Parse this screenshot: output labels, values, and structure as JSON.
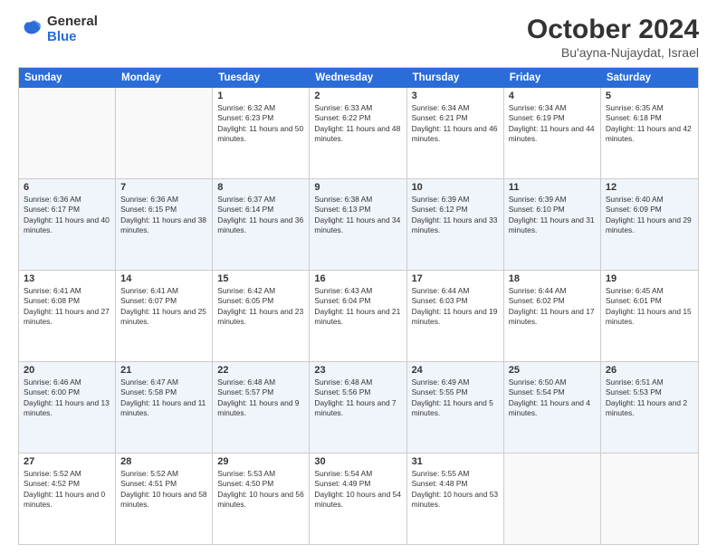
{
  "logo": {
    "general": "General",
    "blue": "Blue"
  },
  "title": "October 2024",
  "subtitle": "Bu'ayna-Nujaydat, Israel",
  "days": [
    "Sunday",
    "Monday",
    "Tuesday",
    "Wednesday",
    "Thursday",
    "Friday",
    "Saturday"
  ],
  "weeks": [
    [
      {
        "day": "",
        "sunrise": "",
        "sunset": "",
        "daylight": "",
        "empty": true
      },
      {
        "day": "",
        "sunrise": "",
        "sunset": "",
        "daylight": "",
        "empty": true
      },
      {
        "day": "1",
        "sunrise": "Sunrise: 6:32 AM",
        "sunset": "Sunset: 6:23 PM",
        "daylight": "Daylight: 11 hours and 50 minutes."
      },
      {
        "day": "2",
        "sunrise": "Sunrise: 6:33 AM",
        "sunset": "Sunset: 6:22 PM",
        "daylight": "Daylight: 11 hours and 48 minutes."
      },
      {
        "day": "3",
        "sunrise": "Sunrise: 6:34 AM",
        "sunset": "Sunset: 6:21 PM",
        "daylight": "Daylight: 11 hours and 46 minutes."
      },
      {
        "day": "4",
        "sunrise": "Sunrise: 6:34 AM",
        "sunset": "Sunset: 6:19 PM",
        "daylight": "Daylight: 11 hours and 44 minutes."
      },
      {
        "day": "5",
        "sunrise": "Sunrise: 6:35 AM",
        "sunset": "Sunset: 6:18 PM",
        "daylight": "Daylight: 11 hours and 42 minutes."
      }
    ],
    [
      {
        "day": "6",
        "sunrise": "Sunrise: 6:36 AM",
        "sunset": "Sunset: 6:17 PM",
        "daylight": "Daylight: 11 hours and 40 minutes."
      },
      {
        "day": "7",
        "sunrise": "Sunrise: 6:36 AM",
        "sunset": "Sunset: 6:15 PM",
        "daylight": "Daylight: 11 hours and 38 minutes."
      },
      {
        "day": "8",
        "sunrise": "Sunrise: 6:37 AM",
        "sunset": "Sunset: 6:14 PM",
        "daylight": "Daylight: 11 hours and 36 minutes."
      },
      {
        "day": "9",
        "sunrise": "Sunrise: 6:38 AM",
        "sunset": "Sunset: 6:13 PM",
        "daylight": "Daylight: 11 hours and 34 minutes."
      },
      {
        "day": "10",
        "sunrise": "Sunrise: 6:39 AM",
        "sunset": "Sunset: 6:12 PM",
        "daylight": "Daylight: 11 hours and 33 minutes."
      },
      {
        "day": "11",
        "sunrise": "Sunrise: 6:39 AM",
        "sunset": "Sunset: 6:10 PM",
        "daylight": "Daylight: 11 hours and 31 minutes."
      },
      {
        "day": "12",
        "sunrise": "Sunrise: 6:40 AM",
        "sunset": "Sunset: 6:09 PM",
        "daylight": "Daylight: 11 hours and 29 minutes."
      }
    ],
    [
      {
        "day": "13",
        "sunrise": "Sunrise: 6:41 AM",
        "sunset": "Sunset: 6:08 PM",
        "daylight": "Daylight: 11 hours and 27 minutes."
      },
      {
        "day": "14",
        "sunrise": "Sunrise: 6:41 AM",
        "sunset": "Sunset: 6:07 PM",
        "daylight": "Daylight: 11 hours and 25 minutes."
      },
      {
        "day": "15",
        "sunrise": "Sunrise: 6:42 AM",
        "sunset": "Sunset: 6:05 PM",
        "daylight": "Daylight: 11 hours and 23 minutes."
      },
      {
        "day": "16",
        "sunrise": "Sunrise: 6:43 AM",
        "sunset": "Sunset: 6:04 PM",
        "daylight": "Daylight: 11 hours and 21 minutes."
      },
      {
        "day": "17",
        "sunrise": "Sunrise: 6:44 AM",
        "sunset": "Sunset: 6:03 PM",
        "daylight": "Daylight: 11 hours and 19 minutes."
      },
      {
        "day": "18",
        "sunrise": "Sunrise: 6:44 AM",
        "sunset": "Sunset: 6:02 PM",
        "daylight": "Daylight: 11 hours and 17 minutes."
      },
      {
        "day": "19",
        "sunrise": "Sunrise: 6:45 AM",
        "sunset": "Sunset: 6:01 PM",
        "daylight": "Daylight: 11 hours and 15 minutes."
      }
    ],
    [
      {
        "day": "20",
        "sunrise": "Sunrise: 6:46 AM",
        "sunset": "Sunset: 6:00 PM",
        "daylight": "Daylight: 11 hours and 13 minutes."
      },
      {
        "day": "21",
        "sunrise": "Sunrise: 6:47 AM",
        "sunset": "Sunset: 5:58 PM",
        "daylight": "Daylight: 11 hours and 11 minutes."
      },
      {
        "day": "22",
        "sunrise": "Sunrise: 6:48 AM",
        "sunset": "Sunset: 5:57 PM",
        "daylight": "Daylight: 11 hours and 9 minutes."
      },
      {
        "day": "23",
        "sunrise": "Sunrise: 6:48 AM",
        "sunset": "Sunset: 5:56 PM",
        "daylight": "Daylight: 11 hours and 7 minutes."
      },
      {
        "day": "24",
        "sunrise": "Sunrise: 6:49 AM",
        "sunset": "Sunset: 5:55 PM",
        "daylight": "Daylight: 11 hours and 5 minutes."
      },
      {
        "day": "25",
        "sunrise": "Sunrise: 6:50 AM",
        "sunset": "Sunset: 5:54 PM",
        "daylight": "Daylight: 11 hours and 4 minutes."
      },
      {
        "day": "26",
        "sunrise": "Sunrise: 6:51 AM",
        "sunset": "Sunset: 5:53 PM",
        "daylight": "Daylight: 11 hours and 2 minutes."
      }
    ],
    [
      {
        "day": "27",
        "sunrise": "Sunrise: 5:52 AM",
        "sunset": "Sunset: 4:52 PM",
        "daylight": "Daylight: 11 hours and 0 minutes."
      },
      {
        "day": "28",
        "sunrise": "Sunrise: 5:52 AM",
        "sunset": "Sunset: 4:51 PM",
        "daylight": "Daylight: 10 hours and 58 minutes."
      },
      {
        "day": "29",
        "sunrise": "Sunrise: 5:53 AM",
        "sunset": "Sunset: 4:50 PM",
        "daylight": "Daylight: 10 hours and 56 minutes."
      },
      {
        "day": "30",
        "sunrise": "Sunrise: 5:54 AM",
        "sunset": "Sunset: 4:49 PM",
        "daylight": "Daylight: 10 hours and 54 minutes."
      },
      {
        "day": "31",
        "sunrise": "Sunrise: 5:55 AM",
        "sunset": "Sunset: 4:48 PM",
        "daylight": "Daylight: 10 hours and 53 minutes."
      },
      {
        "day": "",
        "sunrise": "",
        "sunset": "",
        "daylight": "",
        "empty": true
      },
      {
        "day": "",
        "sunrise": "",
        "sunset": "",
        "daylight": "",
        "empty": true
      }
    ]
  ]
}
